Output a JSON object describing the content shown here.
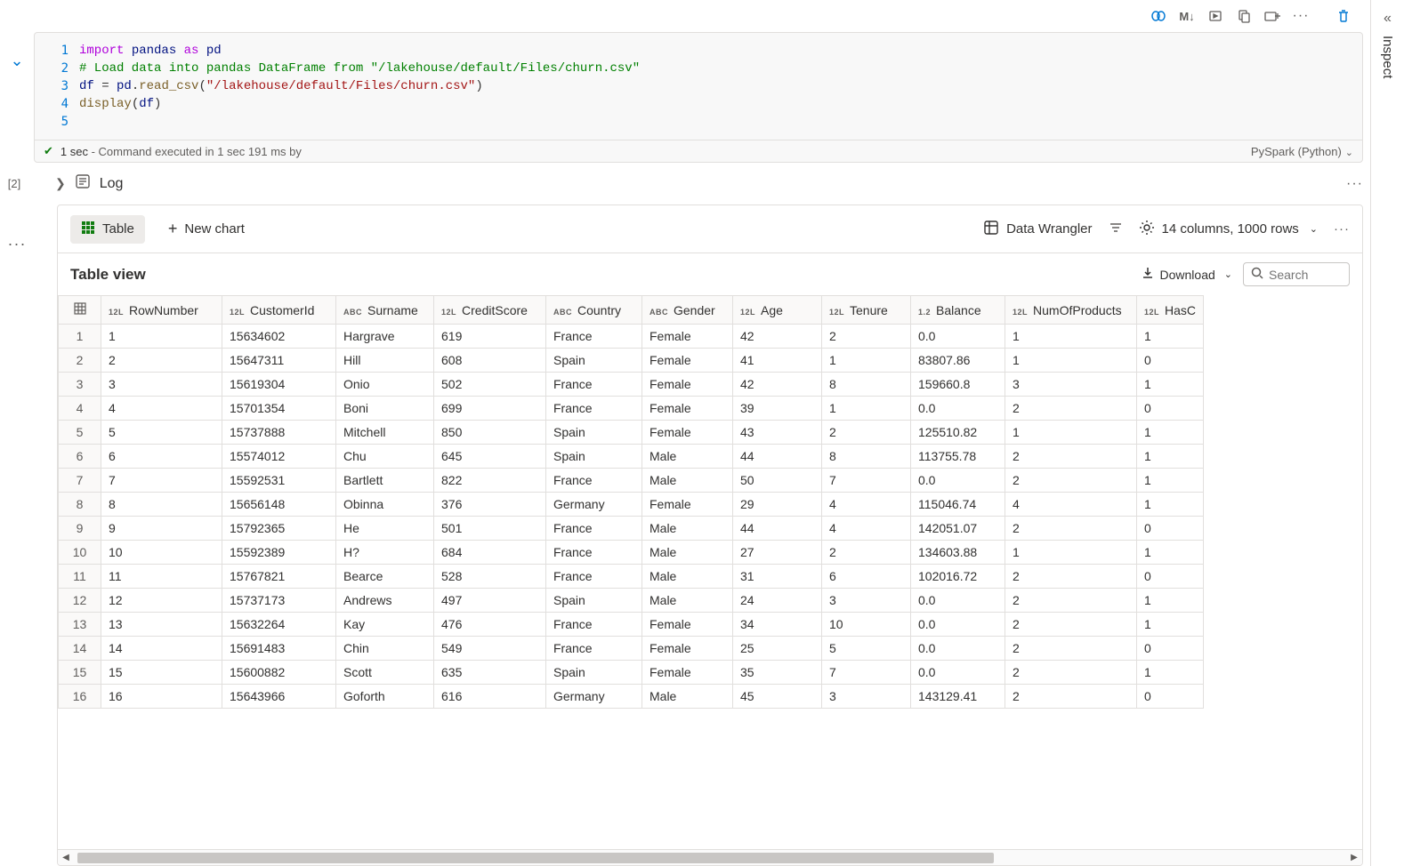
{
  "toolbar": {
    "markdown_label": "M↓"
  },
  "exec_number": "[2]",
  "status": {
    "time": "1 sec",
    "detail": " - Command executed in 1 sec 191 ms by",
    "language": "PySpark (Python)"
  },
  "code": {
    "lines": [
      "1",
      "2",
      "3",
      "4",
      "5"
    ]
  },
  "log_label": "Log",
  "output": {
    "table_btn": "Table",
    "new_chart_btn": "New chart",
    "data_wrangler": "Data Wrangler",
    "cols_rows": "14 columns, 1000 rows",
    "table_view": "Table view",
    "download": "Download",
    "search_placeholder": "Search"
  },
  "sidebar": {
    "inspect": "Inspect"
  },
  "columns": [
    {
      "key": "RowNumber",
      "type": "12L",
      "label": "RowNumber"
    },
    {
      "key": "CustomerId",
      "type": "12L",
      "label": "CustomerId"
    },
    {
      "key": "Surname",
      "type": "ABC",
      "label": "Surname"
    },
    {
      "key": "CreditScore",
      "type": "12L",
      "label": "CreditScore"
    },
    {
      "key": "Country",
      "type": "ABC",
      "label": "Country"
    },
    {
      "key": "Gender",
      "type": "ABC",
      "label": "Gender"
    },
    {
      "key": "Age",
      "type": "12L",
      "label": "Age"
    },
    {
      "key": "Tenure",
      "type": "12L",
      "label": "Tenure"
    },
    {
      "key": "Balance",
      "type": "1.2",
      "label": "Balance"
    },
    {
      "key": "NumOfProducts",
      "type": "12L",
      "label": "NumOfProducts"
    },
    {
      "key": "HasC",
      "type": "12L",
      "label": "HasC"
    }
  ],
  "rows": [
    {
      "i": 1,
      "RowNumber": "1",
      "CustomerId": "15634602",
      "Surname": "Hargrave",
      "CreditScore": "619",
      "Country": "France",
      "Gender": "Female",
      "Age": "42",
      "Tenure": "2",
      "Balance": "0.0",
      "NumOfProducts": "1",
      "HasC": "1"
    },
    {
      "i": 2,
      "RowNumber": "2",
      "CustomerId": "15647311",
      "Surname": "Hill",
      "CreditScore": "608",
      "Country": "Spain",
      "Gender": "Female",
      "Age": "41",
      "Tenure": "1",
      "Balance": "83807.86",
      "NumOfProducts": "1",
      "HasC": "0"
    },
    {
      "i": 3,
      "RowNumber": "3",
      "CustomerId": "15619304",
      "Surname": "Onio",
      "CreditScore": "502",
      "Country": "France",
      "Gender": "Female",
      "Age": "42",
      "Tenure": "8",
      "Balance": "159660.8",
      "NumOfProducts": "3",
      "HasC": "1"
    },
    {
      "i": 4,
      "RowNumber": "4",
      "CustomerId": "15701354",
      "Surname": "Boni",
      "CreditScore": "699",
      "Country": "France",
      "Gender": "Female",
      "Age": "39",
      "Tenure": "1",
      "Balance": "0.0",
      "NumOfProducts": "2",
      "HasC": "0"
    },
    {
      "i": 5,
      "RowNumber": "5",
      "CustomerId": "15737888",
      "Surname": "Mitchell",
      "CreditScore": "850",
      "Country": "Spain",
      "Gender": "Female",
      "Age": "43",
      "Tenure": "2",
      "Balance": "125510.82",
      "NumOfProducts": "1",
      "HasC": "1"
    },
    {
      "i": 6,
      "RowNumber": "6",
      "CustomerId": "15574012",
      "Surname": "Chu",
      "CreditScore": "645",
      "Country": "Spain",
      "Gender": "Male",
      "Age": "44",
      "Tenure": "8",
      "Balance": "113755.78",
      "NumOfProducts": "2",
      "HasC": "1"
    },
    {
      "i": 7,
      "RowNumber": "7",
      "CustomerId": "15592531",
      "Surname": "Bartlett",
      "CreditScore": "822",
      "Country": "France",
      "Gender": "Male",
      "Age": "50",
      "Tenure": "7",
      "Balance": "0.0",
      "NumOfProducts": "2",
      "HasC": "1"
    },
    {
      "i": 8,
      "RowNumber": "8",
      "CustomerId": "15656148",
      "Surname": "Obinna",
      "CreditScore": "376",
      "Country": "Germany",
      "Gender": "Female",
      "Age": "29",
      "Tenure": "4",
      "Balance": "115046.74",
      "NumOfProducts": "4",
      "HasC": "1"
    },
    {
      "i": 9,
      "RowNumber": "9",
      "CustomerId": "15792365",
      "Surname": "He",
      "CreditScore": "501",
      "Country": "France",
      "Gender": "Male",
      "Age": "44",
      "Tenure": "4",
      "Balance": "142051.07",
      "NumOfProducts": "2",
      "HasC": "0"
    },
    {
      "i": 10,
      "RowNumber": "10",
      "CustomerId": "15592389",
      "Surname": "H?",
      "CreditScore": "684",
      "Country": "France",
      "Gender": "Male",
      "Age": "27",
      "Tenure": "2",
      "Balance": "134603.88",
      "NumOfProducts": "1",
      "HasC": "1"
    },
    {
      "i": 11,
      "RowNumber": "11",
      "CustomerId": "15767821",
      "Surname": "Bearce",
      "CreditScore": "528",
      "Country": "France",
      "Gender": "Male",
      "Age": "31",
      "Tenure": "6",
      "Balance": "102016.72",
      "NumOfProducts": "2",
      "HasC": "0"
    },
    {
      "i": 12,
      "RowNumber": "12",
      "CustomerId": "15737173",
      "Surname": "Andrews",
      "CreditScore": "497",
      "Country": "Spain",
      "Gender": "Male",
      "Age": "24",
      "Tenure": "3",
      "Balance": "0.0",
      "NumOfProducts": "2",
      "HasC": "1"
    },
    {
      "i": 13,
      "RowNumber": "13",
      "CustomerId": "15632264",
      "Surname": "Kay",
      "CreditScore": "476",
      "Country": "France",
      "Gender": "Female",
      "Age": "34",
      "Tenure": "10",
      "Balance": "0.0",
      "NumOfProducts": "2",
      "HasC": "1"
    },
    {
      "i": 14,
      "RowNumber": "14",
      "CustomerId": "15691483",
      "Surname": "Chin",
      "CreditScore": "549",
      "Country": "France",
      "Gender": "Female",
      "Age": "25",
      "Tenure": "5",
      "Balance": "0.0",
      "NumOfProducts": "2",
      "HasC": "0"
    },
    {
      "i": 15,
      "RowNumber": "15",
      "CustomerId": "15600882",
      "Surname": "Scott",
      "CreditScore": "635",
      "Country": "Spain",
      "Gender": "Female",
      "Age": "35",
      "Tenure": "7",
      "Balance": "0.0",
      "NumOfProducts": "2",
      "HasC": "1"
    },
    {
      "i": 16,
      "RowNumber": "16",
      "CustomerId": "15643966",
      "Surname": "Goforth",
      "CreditScore": "616",
      "Country": "Germany",
      "Gender": "Male",
      "Age": "45",
      "Tenure": "3",
      "Balance": "143129.41",
      "NumOfProducts": "2",
      "HasC": "0"
    }
  ]
}
